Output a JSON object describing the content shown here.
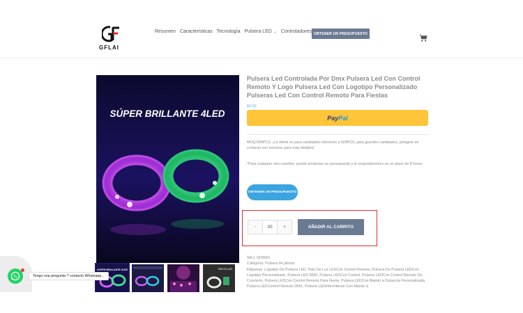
{
  "brand": {
    "logo_text": "GFLAI"
  },
  "nav": {
    "items": [
      "Resumen",
      "Características",
      "Tecnología",
      "Pulsera LED",
      "Controladores"
    ],
    "cta_label": "OBTENER UN PRESUPUESTO"
  },
  "gallery": {
    "main_image_caption": "SÚPER BRILLANTE 4LED",
    "thumb_captions": [
      "SÚPER BRILLANTE 4LED",
      "",
      "",
      "RECICLAR"
    ]
  },
  "product": {
    "title": "Pulsera Led Controlada Por Dmx Pulsera Led Con Control Remoto Y Logo Pulsera Led Con Logotipo Personalizado Pulseras Led Con Control Remoto Para Fiestas",
    "price": "$4.99",
    "paypal_part1": "Pay",
    "paypal_part2": "Pal",
    "description_1": "MOQ:500PCS. ¡La oferta es para cantidades inferiores a 500PCS, para grandes cantidades, póngase en contacto con nosotros para más detalles!",
    "description_2": "*Para cualquier otra cuestión, puede enviarnos un presupuesto y le responderemos en un plazo de 8 horas.",
    "quote_button": "OBTENER UN PRESUPUESTO",
    "qty_minus": "-",
    "qty_value": "20",
    "qty_plus": "+",
    "add_to_cart": "AÑADIR AL CARRITO",
    "sku": "SKU: GFB001",
    "category": "Categoría: Pulsera de pilomo",
    "tags": "Etiquetas: Logotipo De Pulsera LED, Palo De Luz LEDCon Control Remoto, Pulsera De Pulsera LEDCon Logotipo Personalizado, Pulsera LED DMX, Pulsera LEDCon Control, Pulsera LEDCon Control Remoto De Concierto, Pulsera LEDCon Control Remoto Para Fiesta, Pulsera LEDCon Mando a Distancia Personalizada, Pulsera LEDControl Remoto DMX, Pulsera LEDIntermitente Con Mando a"
  },
  "whatsapp": {
    "tooltip": "Tengo una pregunta ? contacto Whatsapp..."
  },
  "colors": {
    "accent_button": "#6a7a92",
    "paypal_yellow": "#ffc439",
    "quote_blue": "#3aa5e0",
    "highlight_red": "#e52b2b",
    "whatsapp_green": "#25d366"
  }
}
